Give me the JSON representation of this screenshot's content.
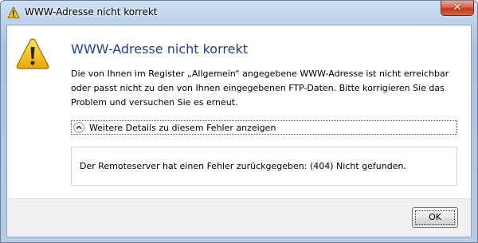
{
  "window": {
    "title": "WWW-Adresse nicht korrekt",
    "close_symbol": "✕",
    "title_icon": "warning-icon"
  },
  "dialog": {
    "icon": "warning-icon",
    "heading": "WWW-Adresse nicht korrekt",
    "message": "Die von Ihnen im Register „Allgemein“ angegebene WWW-Adresse ist nicht erreichbar oder passt nicht zu den von Ihnen eingegebenen FTP-Daten. Bitte korrigieren Sie das Problem und versuchen Sie es erneut.",
    "details_toggle_label": "Weitere Details zu diesem Fehler anzeigen",
    "details_text": "Der Remoteserver hat einen Fehler zurückgegeben: (404) Nicht gefunden.",
    "ok_label": "OK"
  },
  "colors": {
    "heading": "#1f3f8f",
    "warning_yellow": "#f2c21a",
    "close_red": "#c23a1f"
  }
}
